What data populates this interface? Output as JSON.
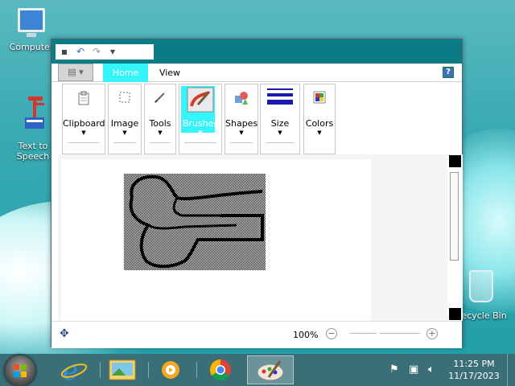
{
  "desktop": {
    "icons": [
      {
        "label": "Computer"
      },
      {
        "label": "Text to Speech"
      },
      {
        "label": "Recycle Bin"
      }
    ]
  },
  "window": {
    "tabs": [
      {
        "label": "Home",
        "active": true
      },
      {
        "label": "View",
        "active": false
      }
    ],
    "ribbon_groups": [
      {
        "label": "Clipboard",
        "icon": "clipboard-icon"
      },
      {
        "label": "Image",
        "icon": "select-icon"
      },
      {
        "label": "Tools",
        "icon": "pencil-icon"
      },
      {
        "label": "Brushes",
        "icon": "brush-icon",
        "active": true
      },
      {
        "label": "Shapes",
        "icon": "shapes-icon"
      },
      {
        "label": "Size",
        "icon": "line-size-icon"
      },
      {
        "label": "Colors",
        "icon": "palette-icon"
      }
    ],
    "zoom_label": "100%",
    "accent_color": "#35f5fb"
  },
  "taskbar": {
    "apps": [
      "internet-explorer-icon",
      "photo-gallery-icon",
      "media-player-icon",
      "chrome-icon",
      "paint-icon"
    ],
    "clock": {
      "time": "11:25 PM",
      "date": "11/17/2023"
    }
  }
}
